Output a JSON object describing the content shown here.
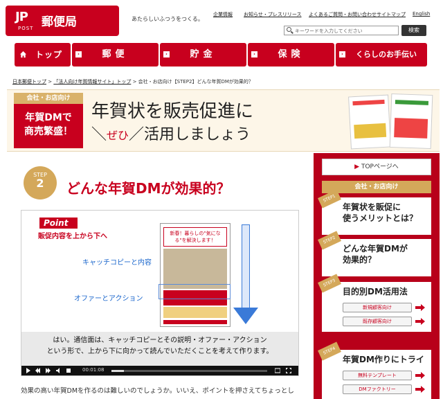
{
  "header": {
    "logo_mark": "JP",
    "logo_post": "POST",
    "logo_name": "郵便局",
    "tagline": "あたらしいふつうをつくる。",
    "util_links": [
      "企業情報",
      "お知らせ・プレスリリース",
      "よくあるご質問・お問い合わせ",
      "サイトマップ",
      "English"
    ],
    "search_placeholder": "キーワードを入力してください",
    "search_button": "検索"
  },
  "nav": {
    "items": [
      {
        "label": "トップ"
      },
      {
        "label": "郵便"
      },
      {
        "label": "貯金"
      },
      {
        "label": "保険"
      },
      {
        "label": "くらしのお手伝い"
      }
    ]
  },
  "breadcrumb": {
    "link1": "日本郵便トップ",
    "link2": "「法人向け年賀情報サイト」トップ",
    "current": "会社・お店向け【STEP2】どんな年賀DMが効果的？"
  },
  "banner": {
    "tag": "会社・お店向け",
    "left_text_1": "年賀DMで",
    "left_text_2": "商売繁盛！",
    "title_line1": "年賀状を販売促進に",
    "title_zehi": "ぜひ",
    "title_line2": "活用しましょう"
  },
  "step": {
    "label": "STEP",
    "number": "2",
    "title": "どんな年賀DMが効果的？"
  },
  "video": {
    "point_label": "Point",
    "point_sub": "販促内容を上から下へ",
    "label_catch": "キャッチコピーと内容",
    "label_offer": "オファーとアクション",
    "flyer_heading": "新春！暮らしの\"気になる\"を解決します！",
    "caption_line1": "はい。通信面は、キャッチコピーとその説明・オファー・アクション",
    "caption_line2": "という形で、上から下に向かって読んでいただくことを考えて作ります。",
    "time": "00:01:08",
    "progress": 0.08
  },
  "body_text": "効果の高い年賀DMを作るのは難しいのでしょうか。いいえ、ポイントを押さえてちょっとし",
  "sidebar": {
    "top_button": "TOPページへ",
    "tag": "会社・お店向け",
    "cards": [
      {
        "step": "STEP1",
        "line1": "年賀状を販促に",
        "line2": "使うメリットとは？"
      },
      {
        "step": "STEP2",
        "line1": "どんな年賀DMが",
        "line2": "効果的？"
      },
      {
        "step": "STEP3",
        "line1": "目的別DM活用法",
        "btn1": "新規顧客向け",
        "btn2": "既存顧客向け"
      },
      {
        "step": "STEP4",
        "line1": "年賀DM作りにトライ",
        "btn1": "無料テンプレート",
        "btn2": "DMファクトリー"
      }
    ]
  },
  "colors": {
    "brand_red": "#c8001e",
    "gold": "#d4a85a",
    "link_blue": "#1a66cc"
  }
}
